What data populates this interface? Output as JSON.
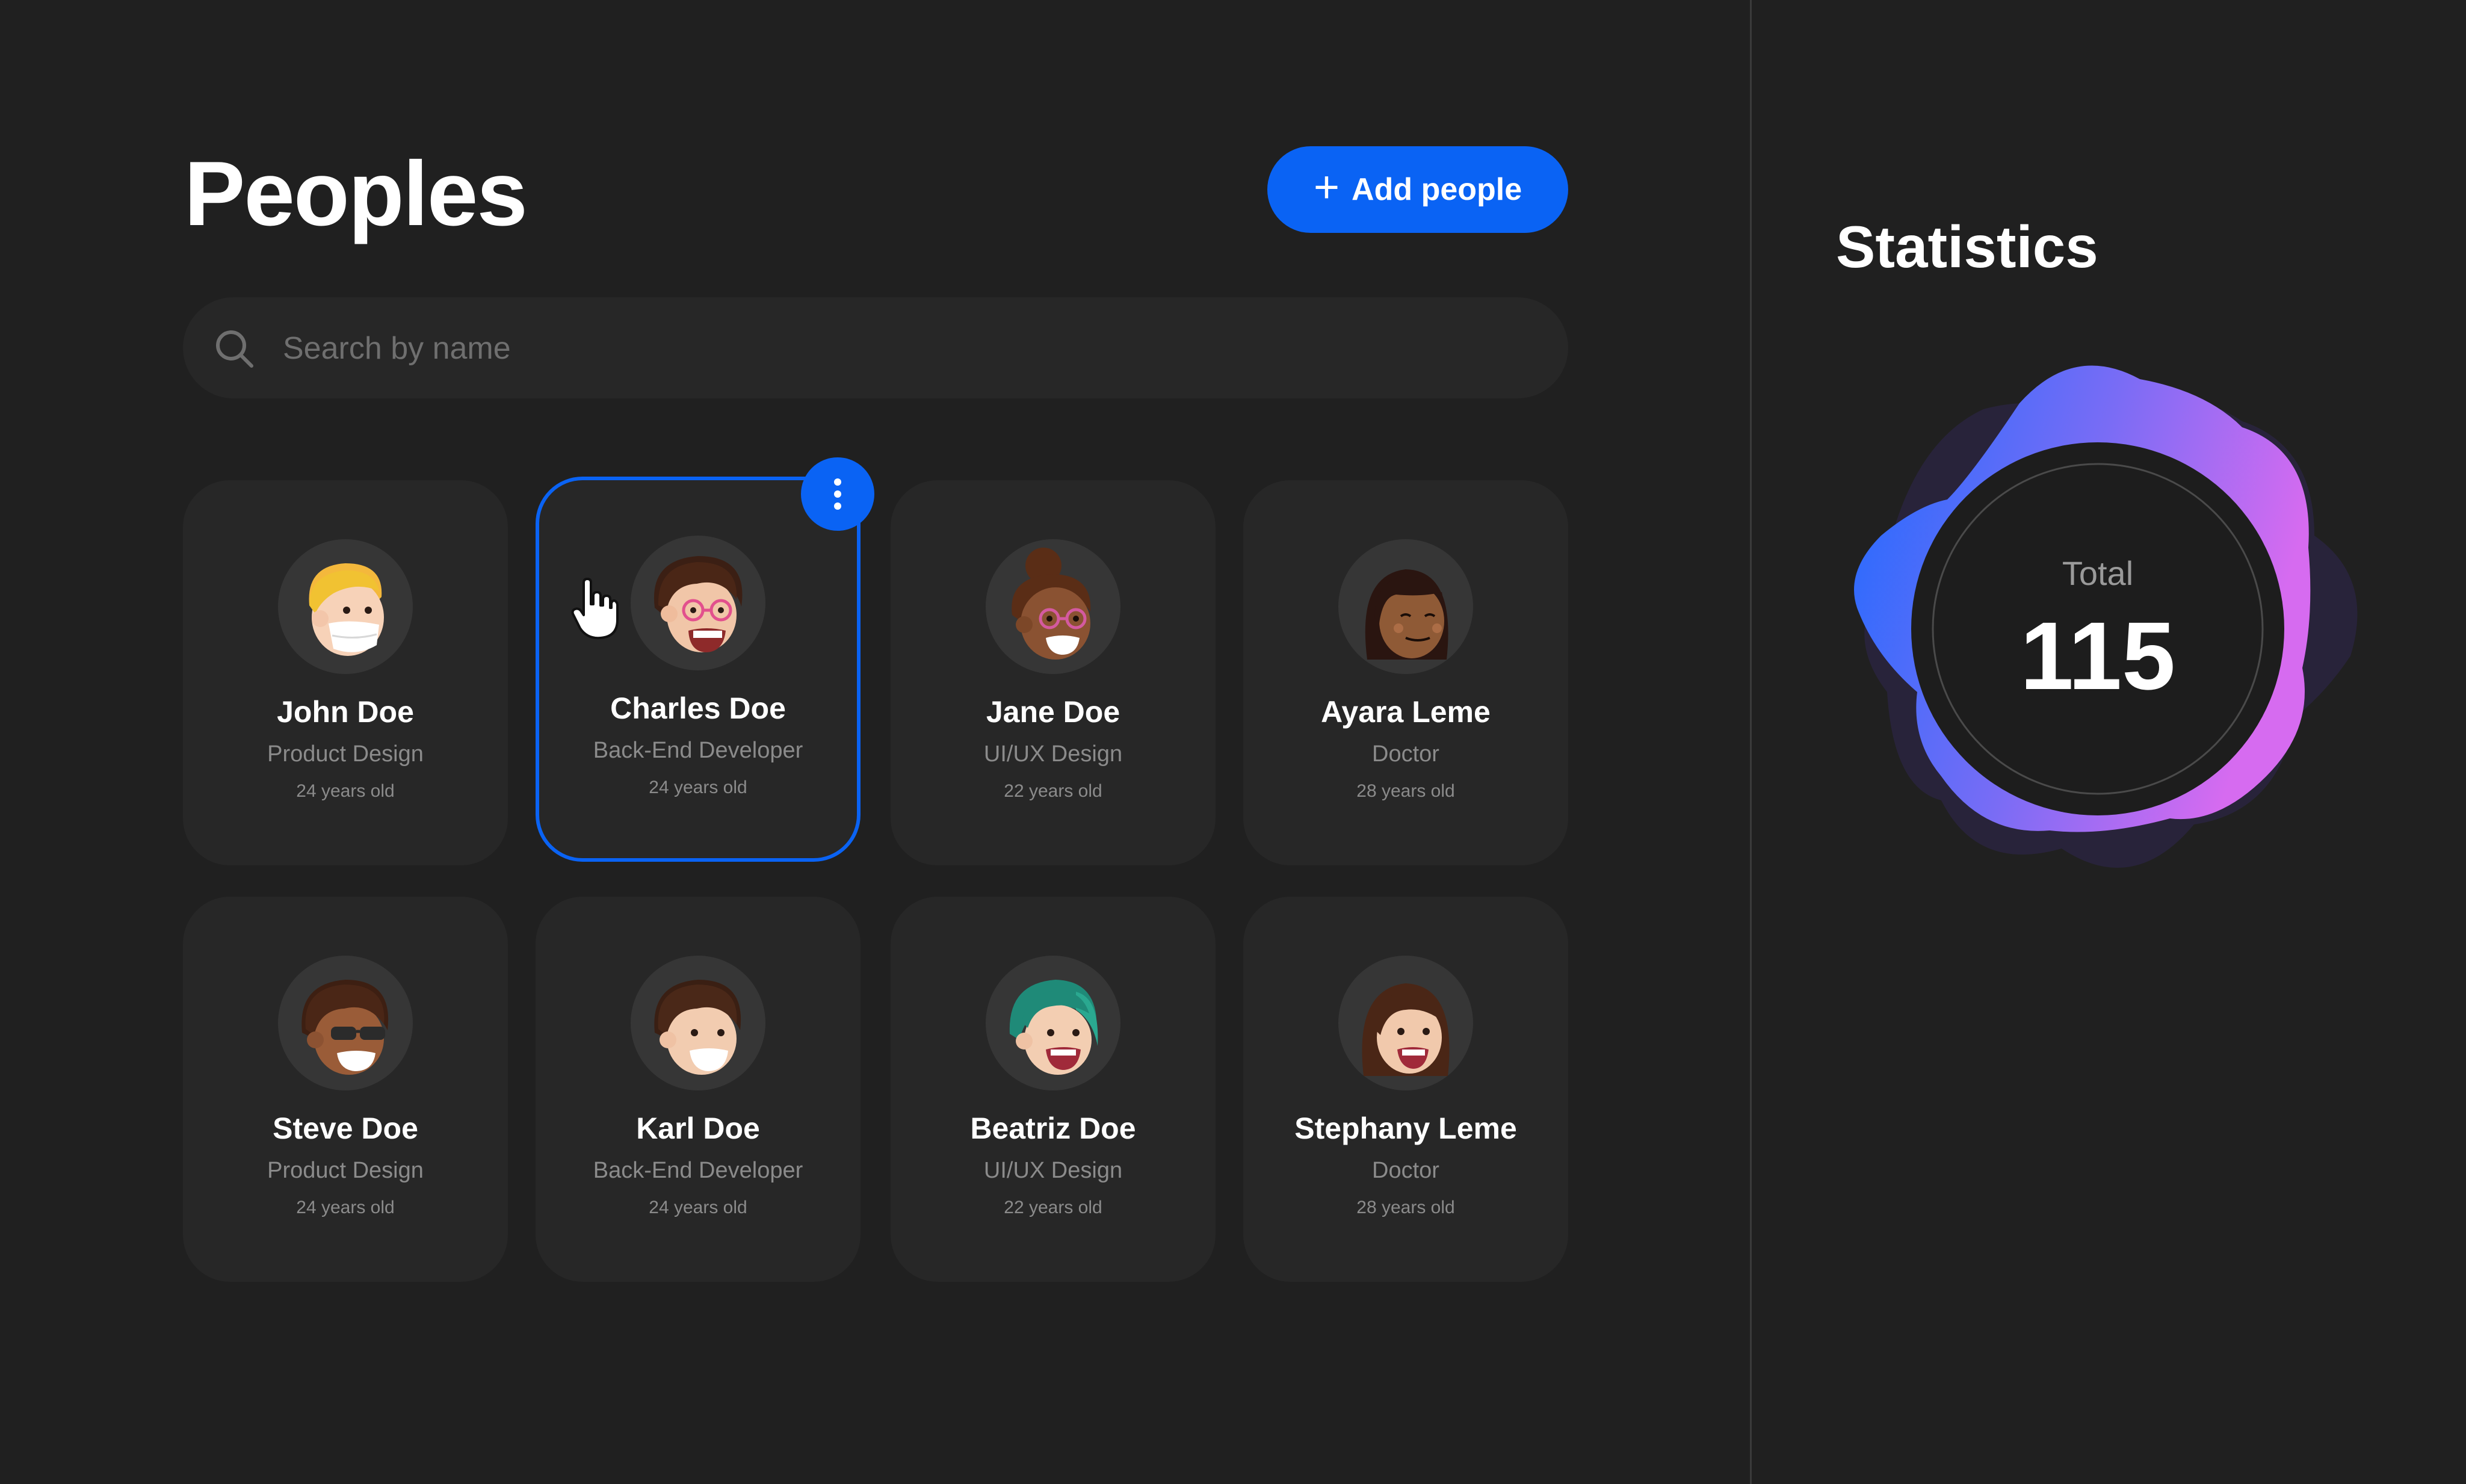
{
  "header": {
    "title": "Peoples",
    "add_button_label": "Add people",
    "add_button_icon": "plus-icon"
  },
  "search": {
    "placeholder": "Search by name",
    "value": "",
    "icon": "search-icon"
  },
  "people": [
    {
      "name": "John Doe",
      "role": "Product Design",
      "age": "24 years old"
    },
    {
      "name": "Charles Doe",
      "role": "Back-End Developer",
      "age": "24 years old",
      "selected": true
    },
    {
      "name": "Jane Doe",
      "role": "UI/UX Design",
      "age": "22 years old"
    },
    {
      "name": "Ayara Leme",
      "role": "Doctor",
      "age": "28 years old"
    },
    {
      "name": "Steve Doe",
      "role": "Product Design",
      "age": "24 years old"
    },
    {
      "name": "Karl Doe",
      "role": "Back-End Developer",
      "age": "24 years old"
    },
    {
      "name": "Beatriz Doe",
      "role": "UI/UX Design",
      "age": "22 years old"
    },
    {
      "name": "Stephany Leme",
      "role": "Doctor",
      "age": "28 years old"
    }
  ],
  "card_menu_icon": "more-vertical-icon",
  "statistics": {
    "title": "Statistics",
    "total_label": "Total",
    "total_value": "115"
  },
  "colors": {
    "background": "#202020",
    "card": "#272727",
    "accent": "#0a63f4",
    "gradient_start": "#1e6bff",
    "gradient_end": "#d66bf0",
    "muted_text": "#8b8b8b"
  }
}
